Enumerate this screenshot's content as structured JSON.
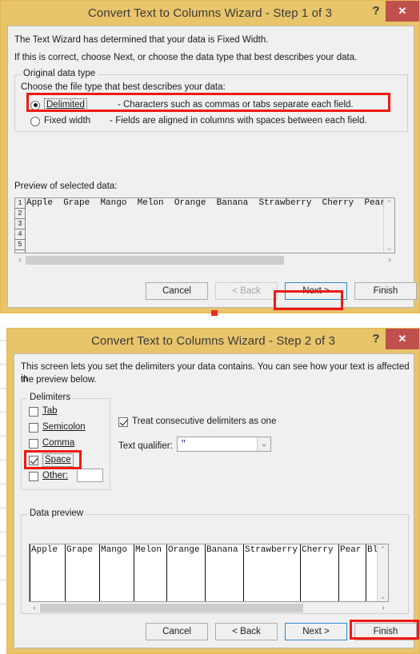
{
  "step1": {
    "title": "Convert Text to Columns Wizard - Step 1 of 3",
    "help_label": "?",
    "close_label": "✕",
    "intro_line1": "The Text Wizard has determined that your data is Fixed Width.",
    "intro_line2": "If this is correct, choose Next, or choose the data type that best describes your data.",
    "group_title": "Original data type",
    "group_prompt": "Choose the file type that best describes your data:",
    "options": [
      {
        "label": "Delimited",
        "accel": "D",
        "description": "- Characters such as commas or tabs separate each field.",
        "selected": true
      },
      {
        "label": "Fixed width",
        "accel": "w",
        "description": "- Fields are aligned in columns with spaces between each field.",
        "selected": false
      }
    ],
    "preview_label": "Preview of selected data:",
    "preview_rows": [
      "1",
      "2",
      "3",
      "4",
      "5"
    ],
    "preview_line1": "Apple  Grape  Mango  Melon  Orange  Banana  Strawberry  Cherry  Pear  Bl",
    "scroll_left": "‹",
    "scroll_right": "›",
    "scroll_up": "⌃",
    "scroll_down": "⌄",
    "buttons": [
      {
        "label": "Cancel",
        "state": "normal"
      },
      {
        "label": "< Back",
        "state": "disabled"
      },
      {
        "label": "Next >",
        "state": "focus"
      },
      {
        "label": "Finish",
        "state": "normal"
      }
    ]
  },
  "step2": {
    "title": "Convert Text to Columns Wizard - Step 2 of 3",
    "help_label": "?",
    "close_label": "✕",
    "intro_line1": "This screen lets you set the delimiters your data contains.  You can see how your text is affected in",
    "intro_line2": "the preview below.",
    "delimiters_group_title": "Delimiters",
    "delimiters": [
      {
        "label": "Tab",
        "checked": false
      },
      {
        "label": "Semicolon",
        "checked": false
      },
      {
        "label": "Comma",
        "checked": false
      },
      {
        "label": "Space",
        "checked": true
      },
      {
        "label": "Other:",
        "checked": false
      }
    ],
    "other_value": "",
    "consecutive_label": "Treat consecutive delimiters as one",
    "consecutive_checked": true,
    "qualifier_label": "Text qualifier:",
    "qualifier_value": "\"",
    "qualifier_arrow": "⌄",
    "data_preview_title": "Data preview",
    "data_columns": [
      "Apple",
      "Grape",
      "Mango",
      "Melon",
      "Orange",
      "Banana",
      "Strawberry",
      "Cherry",
      "Pear",
      "Blac"
    ],
    "scroll_left": "‹",
    "scroll_right": "›",
    "scroll_up": "⌃",
    "scroll_down": "⌄",
    "buttons": [
      {
        "label": "Cancel",
        "state": "normal"
      },
      {
        "label": "< Back",
        "state": "normal"
      },
      {
        "label": "Next >",
        "state": "focus"
      },
      {
        "label": "Finish",
        "state": "normal"
      }
    ]
  },
  "annotations": {
    "highlight_color": "#f01a12",
    "arrow_color": "#ee2b20"
  }
}
